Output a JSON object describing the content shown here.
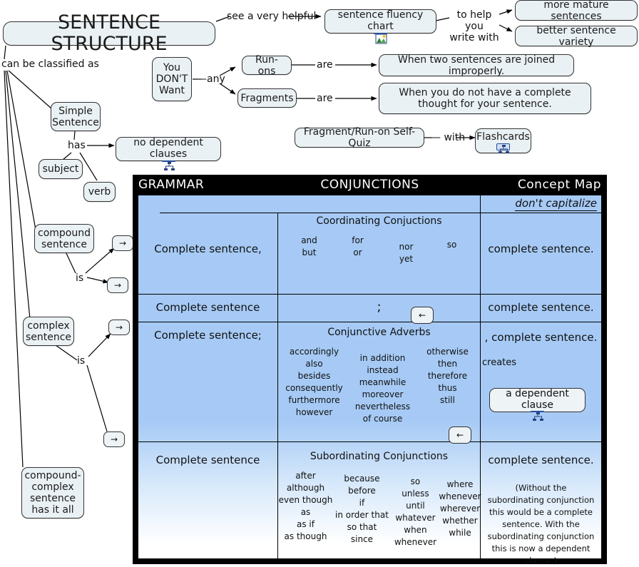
{
  "title_node": {
    "label": "SENTENCE STRUCTURE"
  },
  "map_labels": {
    "classified": "can be classified as",
    "has": "has",
    "is_compound": "is",
    "is_complex": "is",
    "any": "—any",
    "are1": "are",
    "are2": "are",
    "with": "— with",
    "see_helpful": "see a very helpful",
    "to_help": "to help you\nwrite with",
    "creates": "creates"
  },
  "nodes": {
    "simple_sentence": "Simple\nSentence",
    "no_dependent_clauses": "no dependent clauses",
    "subject": "subject",
    "verb": "verb",
    "compound_sentence": "compound\nsentence",
    "complex_sentence": "complex\nsentence",
    "compound_complex": "compound-\ncomplex\nsentence\nhas it all",
    "you_dont_want": "You\nDON'T\nWant",
    "run_ons": "Run-ons",
    "fragments": "Fragments",
    "run_on_def": "When two sentences are joined improperly.",
    "fragment_def": "When you do not have a complete thought for your sentence.",
    "self_quiz": "Fragment/Run-on Self-Quiz",
    "flashcards": "Flashcards",
    "fluency_chart": "sentence fluency chart",
    "more_mature": "more mature sentences",
    "better_variety": "better sentence variety",
    "dependent_clause": "a dependent clause",
    "arrow_right": "→",
    "arrow_left": "←"
  },
  "icons": {
    "concept_map_badge": "concept-map-icon",
    "picture_badge": "picture-icon"
  },
  "poster": {
    "header": {
      "left": "GRAMMAR",
      "center": "CONJUNCTIONS",
      "right": "Concept Map"
    },
    "capitalize_note": "don't capitalize",
    "rows": [
      {
        "left": "Complete sentence,",
        "center_title": "Coordinating Conjuctions",
        "words": [
          [
            "and",
            "but"
          ],
          [
            "for",
            "or"
          ],
          [
            "nor",
            "yet"
          ],
          [
            "so"
          ]
        ],
        "right": "complete sentence."
      },
      {
        "left": "Complete sentence",
        "center_title": ";",
        "words": [],
        "right": "complete sentence."
      },
      {
        "left": "Complete sentence;",
        "center_title": "Conjunctive Adverbs",
        "words": [
          [
            "accordingly",
            "also",
            "besides",
            "consequently",
            "furthermore",
            "however"
          ],
          [
            "in addition",
            "instead",
            "meanwhile",
            "moreover",
            "nevertheless",
            "of course"
          ],
          [
            "otherwise",
            "then",
            "therefore",
            "thus",
            "still"
          ]
        ],
        "right": ", complete sentence."
      },
      {
        "left": "Complete sentence",
        "center_title": "Subordinating Conjunctions",
        "words": [
          [
            "after",
            "although",
            "even though",
            "as",
            "as if",
            "as though"
          ],
          [
            "because",
            "before",
            "if",
            "in order that",
            "so that",
            "since"
          ],
          [
            "so",
            "unless",
            "until",
            "whatever",
            "when",
            "whenever"
          ],
          [
            "where",
            "whenever",
            "wherever",
            "whether",
            "while"
          ]
        ],
        "right": "complete sentence.",
        "note": "(Without the subordinating conjunction this would be a complete sentence. With the subordinating conjunction this is now a dependent clause.)"
      }
    ]
  },
  "colors": {
    "node_fill": "#eaf1f4",
    "table_blue": "#a6caf5",
    "frame": "#000000",
    "badge_blue": "#274f9c"
  }
}
